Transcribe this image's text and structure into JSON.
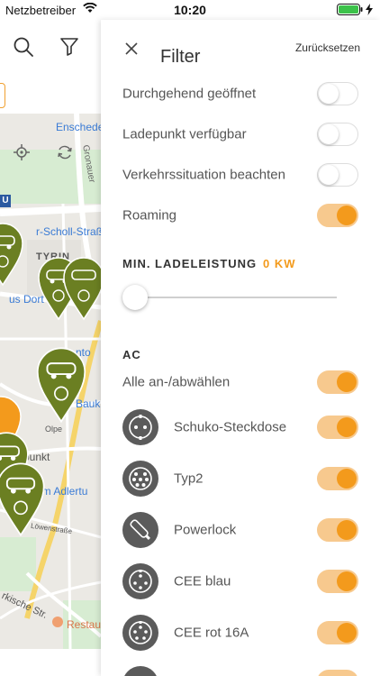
{
  "status_bar": {
    "carrier": "Netzbetreiber",
    "time": "10:20"
  },
  "map": {
    "labels": {
      "enschede": "Enschede",
      "gronau": "Gronauer",
      "scholl": "r-Scholl-Straße",
      "tyrin": "TYRIN",
      "dortmund": "us Dort",
      "nto": "nto",
      "bauk": "Bauk",
      "olpe": "Olpe",
      "punkt": "punkt",
      "adlerturm": "um Adlertu",
      "loewen": "Löwenstraße",
      "markische": "rkische Str.",
      "restau": "Restau",
      "u_sign": "U"
    },
    "accent_green": "#6b7f22",
    "accent_orange": "#f39a1c"
  },
  "filter": {
    "title": "Filter",
    "reset_label": "Zurücksetzen",
    "options": [
      {
        "label": "Durchgehend geöffnet",
        "state": "off"
      },
      {
        "label": "Ladepunkt verfügbar",
        "state": "off"
      },
      {
        "label": "Verkehrssituation beachten",
        "state": "off"
      },
      {
        "label": "Roaming",
        "state": "on"
      }
    ],
    "power": {
      "heading": "MIN. LADELEISTUNG",
      "value": "0 KW",
      "slider_fraction": 0.0
    },
    "ac": {
      "heading": "AC",
      "select_all_label": "Alle an-/abwählen",
      "connectors": [
        {
          "label": "Schuko-Steckdose",
          "icon": "schuko-plug-icon",
          "state": "on"
        },
        {
          "label": "Typ2",
          "icon": "type2-plug-icon",
          "state": "on"
        },
        {
          "label": "Powerlock",
          "icon": "powerlock-plug-icon",
          "state": "on"
        },
        {
          "label": "CEE blau",
          "icon": "cee-blue-plug-icon",
          "state": "on"
        },
        {
          "label": "CEE rot 16A",
          "icon": "cee-red-plug-icon",
          "state": "on"
        }
      ]
    },
    "toggle_on_color": "#f39a1c",
    "toggle_on_track": "#f7c98e"
  }
}
